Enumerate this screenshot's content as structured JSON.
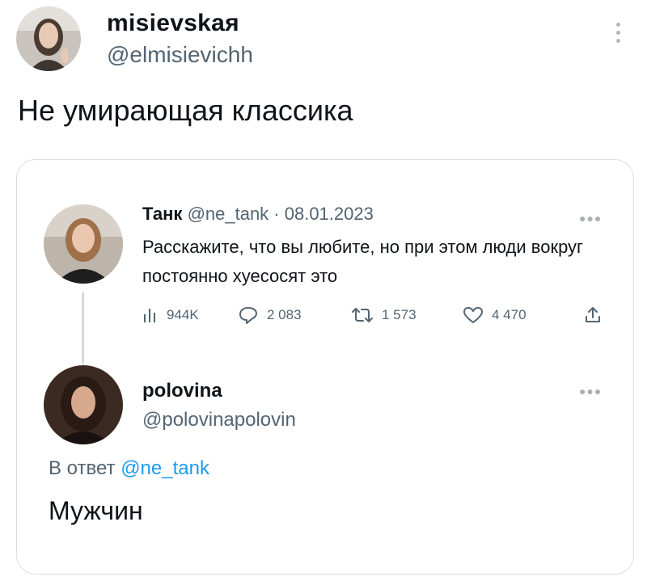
{
  "author": {
    "name": "misievskaя",
    "handle": "@elmisievichh"
  },
  "tweet": {
    "text": "Не умирающая классика",
    "menu_icon": "vertical-ellipsis-icon"
  },
  "quoted": {
    "name": "Танк",
    "handle_date": "@ne_tank · 08.01.2023",
    "body": "Расскажите, что вы любите, но при этом люди вокруг постоянно хуесосят это",
    "metrics": {
      "views": "944K",
      "replies": "2 083",
      "retweets": "1 573",
      "likes": "4 470"
    },
    "menu_icon": "horizontal-ellipsis-icon"
  },
  "reply": {
    "name": "polovina",
    "handle": "@polovinapolovin",
    "reply_prefix": "В ответ",
    "reply_to": "@ne_tank",
    "text": "Мужчин"
  },
  "colors": {
    "text": "#0f1419",
    "secondary": "#536471",
    "link": "#1d9bf0",
    "border": "#d9dee2"
  }
}
